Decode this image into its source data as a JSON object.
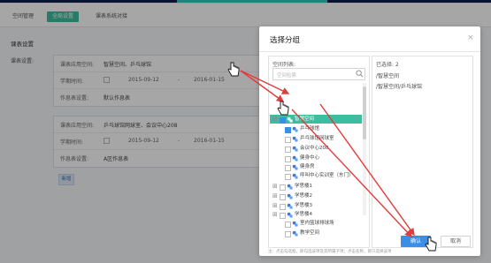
{
  "tabs": [
    {
      "label": "空间管理"
    },
    {
      "label": "全局设置"
    },
    {
      "label": "课表系统对接"
    }
  ],
  "section_title": "课表设置",
  "side_label": "课表设置:",
  "cards": [
    {
      "rows": [
        {
          "label": "课表应用空间:",
          "value": "智慧空间、乒乓球馆"
        },
        {
          "label": "学期时间:",
          "start": "2015-09-12",
          "dash": "-",
          "end": "2016-01-15"
        },
        {
          "label": "作息表设置:",
          "value": "默认作息表"
        }
      ]
    },
    {
      "rows": [
        {
          "label": "课表应用空间:",
          "value": "乒乓球馆网球室、会议中心208"
        },
        {
          "label": "学期时间:",
          "start": "2015-09-12",
          "dash": "-",
          "end": "2016-01-15"
        },
        {
          "label": "作息表设置:",
          "value": "A区作息表"
        }
      ]
    }
  ],
  "add_button": "新增",
  "modal": {
    "title": "选择分组",
    "close": "×",
    "left_title": "空间列表:",
    "search_placeholder": "空间检索",
    "tree": [
      {
        "label": "智慧空间",
        "checked": true,
        "expander": "⊟"
      },
      {
        "label": "乒乓球馆",
        "checked": true,
        "expander": ""
      },
      {
        "label": "乒乓球馆网球室",
        "checked": false,
        "expander": ""
      },
      {
        "label": "会议中心208",
        "checked": false,
        "expander": ""
      },
      {
        "label": "健身中心",
        "checked": false,
        "expander": ""
      },
      {
        "label": "健身房",
        "checked": false,
        "expander": ""
      },
      {
        "label": "呼叫中心实训室（东门）",
        "checked": false,
        "expander": ""
      },
      {
        "label": "学思楼1",
        "checked": false,
        "expander": "⊞"
      },
      {
        "label": "学思楼2",
        "checked": false,
        "expander": "⊞"
      },
      {
        "label": "学思楼3",
        "checked": false,
        "expander": "⊞"
      },
      {
        "label": "学思楼4",
        "checked": false,
        "expander": "⊞"
      },
      {
        "label": "室内篮球排球场",
        "checked": false,
        "expander": ""
      },
      {
        "label": "教学空间",
        "checked": false,
        "expander": ""
      }
    ],
    "right_title": "已选择: 2",
    "selected": [
      "/智慧空间",
      "/智慧空间/乒乓球馆"
    ],
    "note": "注：点击勾选框，即勾选该项及其所属子项；点击名称，即只选择该项",
    "ok_label": "确认",
    "cancel_label": "取消"
  },
  "colors": {
    "accent_green": "#3dbd9f",
    "primary_blue": "#3a8ee6",
    "annotation_red": "#e23b3b"
  }
}
